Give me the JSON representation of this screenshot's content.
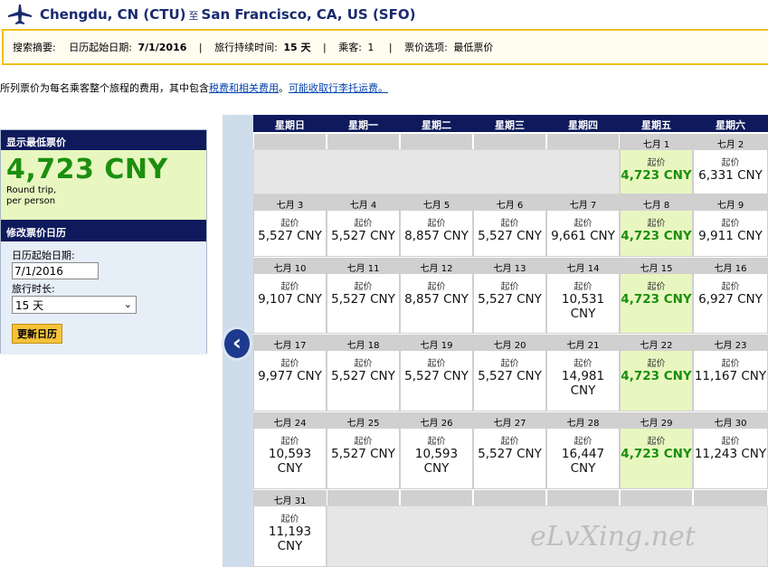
{
  "header": {
    "origin": "Chengdu, CN (CTU)",
    "to_label": "至",
    "destination": "San Francisco, CA, US (SFO)"
  },
  "summary": {
    "label": "搜索摘要:",
    "start_label": "日历起始日期:",
    "start_value": "7/1/2016",
    "duration_label": "旅行持续时间:",
    "duration_value": "15 天",
    "passengers_label": "乘客:",
    "passengers_value": "1",
    "option_label": "票价选项:",
    "option_value": "最低票价"
  },
  "notice": {
    "text1": "所列票价为每名乘客整个旅程的费用，其中包含",
    "link1": "税费和相关费用",
    "text2": "。",
    "link2": "可能收取行李托运费。"
  },
  "left_panel": {
    "lowest_heading": "显示最低票价",
    "lowest_price": "4,723 CNY",
    "round_trip": "Round trip,",
    "per_person": "per person",
    "modify_heading": "修改票价日历",
    "start_label": "日历起始日期:",
    "start_value": "7/1/2016",
    "duration_label": "旅行时长:",
    "duration_value": "15 天",
    "update_button": "更新日历"
  },
  "calendar": {
    "weekdays": [
      "星期日",
      "星期一",
      "星期二",
      "星期三",
      "星期四",
      "星期五",
      "星期六"
    ],
    "from_label": "起价",
    "lowest_color": "#1c8f0f",
    "days": [
      {
        "date": "七月 1",
        "price": "4,723 CNY",
        "lowest": true
      },
      {
        "date": "七月 2",
        "price": "6,331 CNY",
        "lowest": false
      },
      {
        "date": "七月 3",
        "price": "5,527 CNY",
        "lowest": false
      },
      {
        "date": "七月 4",
        "price": "5,527 CNY",
        "lowest": false
      },
      {
        "date": "七月 5",
        "price": "8,857 CNY",
        "lowest": false
      },
      {
        "date": "七月 6",
        "price": "5,527 CNY",
        "lowest": false
      },
      {
        "date": "七月 7",
        "price": "9,661 CNY",
        "lowest": false
      },
      {
        "date": "七月 8",
        "price": "4,723 CNY",
        "lowest": true
      },
      {
        "date": "七月 9",
        "price": "9,911 CNY",
        "lowest": false
      },
      {
        "date": "七月 10",
        "price": "9,107 CNY",
        "lowest": false
      },
      {
        "date": "七月 11",
        "price": "5,527 CNY",
        "lowest": false
      },
      {
        "date": "七月 12",
        "price": "8,857 CNY",
        "lowest": false
      },
      {
        "date": "七月 13",
        "price": "5,527 CNY",
        "lowest": false
      },
      {
        "date": "七月 14",
        "price": "10,531 CNY",
        "lowest": false
      },
      {
        "date": "七月 15",
        "price": "4,723 CNY",
        "lowest": true
      },
      {
        "date": "七月 16",
        "price": "6,927 CNY",
        "lowest": false
      },
      {
        "date": "七月 17",
        "price": "9,977 CNY",
        "lowest": false
      },
      {
        "date": "七月 18",
        "price": "5,527 CNY",
        "lowest": false
      },
      {
        "date": "七月 19",
        "price": "5,527 CNY",
        "lowest": false
      },
      {
        "date": "七月 20",
        "price": "5,527 CNY",
        "lowest": false
      },
      {
        "date": "七月 21",
        "price": "14,981 CNY",
        "lowest": false
      },
      {
        "date": "七月 22",
        "price": "4,723 CNY",
        "lowest": true
      },
      {
        "date": "七月 23",
        "price": "11,167 CNY",
        "lowest": false
      },
      {
        "date": "七月 24",
        "price": "10,593 CNY",
        "lowest": false
      },
      {
        "date": "七月 25",
        "price": "5,527 CNY",
        "lowest": false
      },
      {
        "date": "七月 26",
        "price": "10,593 CNY",
        "lowest": false
      },
      {
        "date": "七月 27",
        "price": "5,527 CNY",
        "lowest": false
      },
      {
        "date": "七月 28",
        "price": "16,447 CNY",
        "lowest": false
      },
      {
        "date": "七月 29",
        "price": "4,723 CNY",
        "lowest": true
      },
      {
        "date": "七月 30",
        "price": "11,243 CNY",
        "lowest": false
      },
      {
        "date": "七月 31",
        "price": "11,193 CNY",
        "lowest": false
      }
    ]
  },
  "icons": {
    "plane": "airplane-icon",
    "prev": "chevron-left-icon",
    "dropdown": "chevron-down-icon"
  },
  "watermark": "eLvXing.net"
}
